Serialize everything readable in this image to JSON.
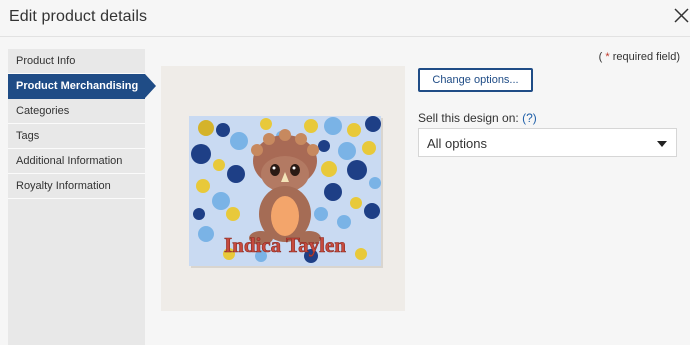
{
  "dialog": {
    "title": "Edit product details"
  },
  "sidebar": {
    "items": [
      {
        "label": "Product Info"
      },
      {
        "label": "Product Merchandising"
      },
      {
        "label": "Categories"
      },
      {
        "label": "Tags"
      },
      {
        "label": "Additional Information"
      },
      {
        "label": "Royalty Information"
      }
    ],
    "active_index": 1
  },
  "form": {
    "required_open": "( ",
    "required_star": "*",
    "required_text": " required field)",
    "change_options_label": "Change options...",
    "sell_label": "Sell this design on:",
    "sell_help": "(?)",
    "sell_select_value": "All options"
  },
  "preview": {
    "name_text": "Indica Taylen"
  },
  "colors": {
    "accent": "#1f4c86",
    "link": "#1f5fa8",
    "required_star": "#c0392b",
    "sidebar_bg": "#e8e8e8"
  },
  "icons": {
    "close": "close-icon",
    "dropdown": "chevron-down-icon"
  }
}
